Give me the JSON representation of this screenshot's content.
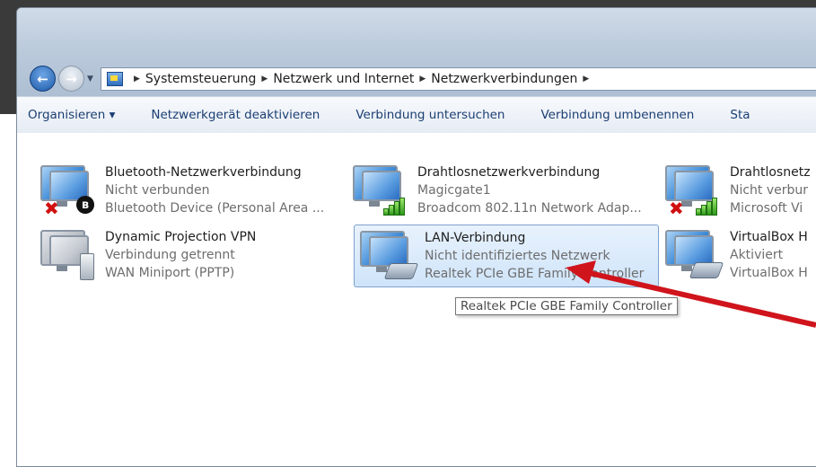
{
  "breadcrumb": [
    "Systemsteuerung",
    "Netzwerk und Internet",
    "Netzwerkverbindungen"
  ],
  "toolbar": {
    "organize": "Organisieren ▾",
    "disable": "Netzwerkgerät deaktivieren",
    "diagnose": "Verbindung untersuchen",
    "rename": "Verbindung umbenennen",
    "more": "Sta"
  },
  "connections": [
    {
      "name": "Bluetooth-Netzwerkverbindung",
      "status": "Nicht verbunden",
      "device": "Bluetooth Device (Personal Area ...",
      "icon": "bluetooth-adapter-icon"
    },
    {
      "name": "Drahtlosnetzwerkverbindung",
      "status": "Magicgate1",
      "device": "Broadcom 802.11n Network Adap...",
      "icon": "wireless-adapter-icon"
    },
    {
      "name": "Drahtlosnetz",
      "status": "Nicht verbur",
      "device": "Microsoft Vi",
      "icon": "wireless-adapter-icon"
    },
    {
      "name": "Dynamic Projection VPN",
      "status": "Verbindung getrennt",
      "device": "WAN Miniport (PPTP)",
      "icon": "vpn-icon"
    },
    {
      "name": "LAN-Verbindung",
      "status": "Nicht identifiziertes Netzwerk",
      "device": "Realtek PCIe GBE Family Controller",
      "icon": "ethernet-adapter-icon"
    },
    {
      "name": "VirtualBox H",
      "status": "Aktiviert",
      "device": "VirtualBox H",
      "icon": "ethernet-adapter-icon"
    }
  ],
  "tooltip": "Realtek PCIe GBE Family Controller",
  "colors": {
    "selection": "#cfe4fa",
    "arrow": "#d0141c",
    "link": "#1b3e73"
  }
}
